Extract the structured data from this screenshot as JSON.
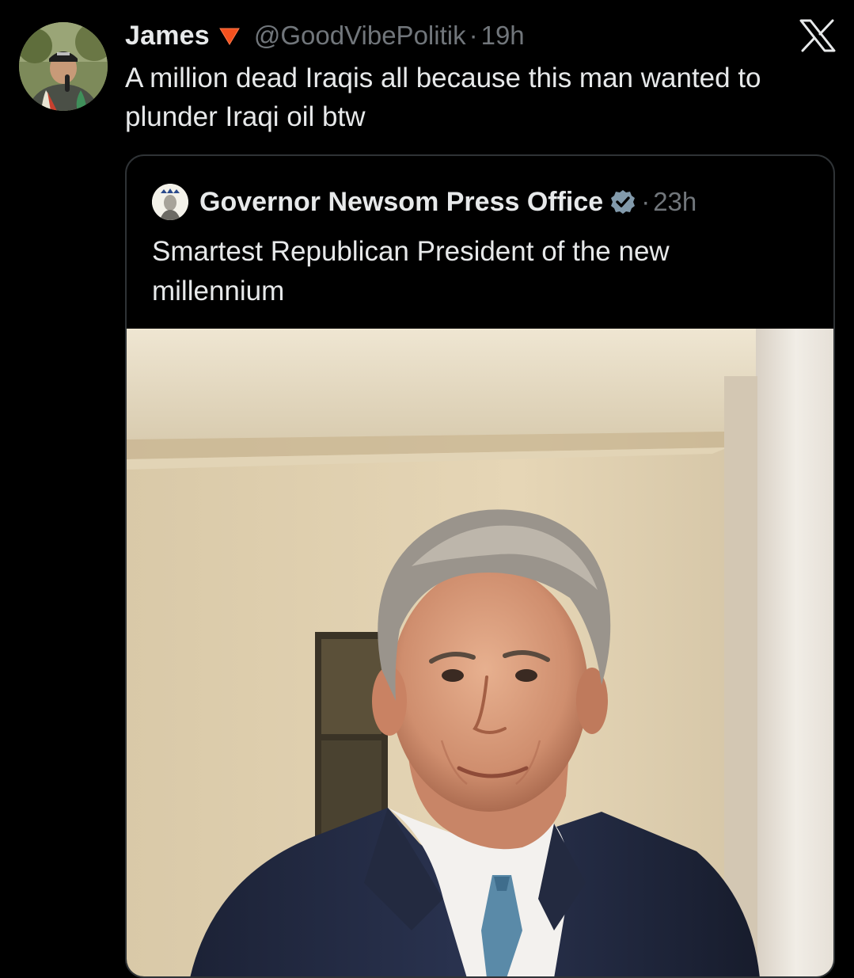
{
  "tweet": {
    "display_name": "James",
    "name_badge_icon": "red-triangle-down-icon",
    "handle": "@GoodVibePolitik",
    "separator": "·",
    "time": "19h",
    "text": "A million dead Iraqis all because this man wanted to plunder Iraqi oil btw",
    "platform_icon": "x-logo-icon"
  },
  "quote": {
    "display_name": "Governor Newsom Press Office",
    "verified_icon": "verified-badge-icon",
    "separator": "·",
    "time": "23h",
    "text": "Smartest Republican President of the new millennium",
    "media_description_icon": "portrait-photo"
  },
  "colors": {
    "background": "#000000",
    "primary_text": "#e7e9ea",
    "secondary_text": "#71767b",
    "border": "#2f3336",
    "badge_red": "#f4511e"
  }
}
